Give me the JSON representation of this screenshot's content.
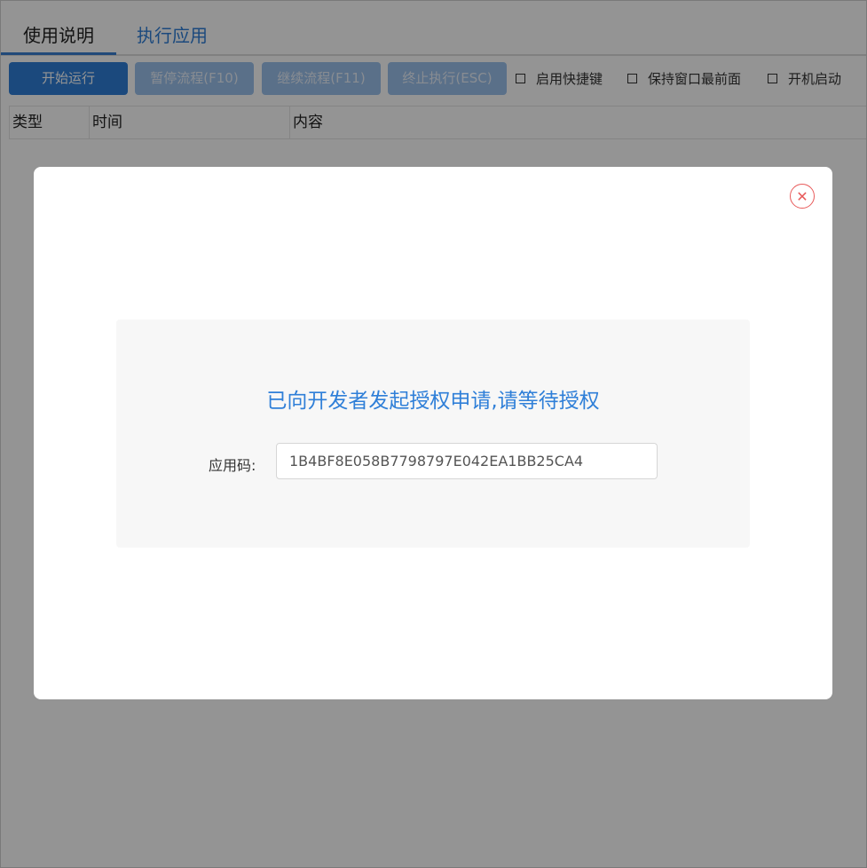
{
  "tabs": [
    {
      "label": "使用说明"
    },
    {
      "label": "执行应用"
    }
  ],
  "toolbar": {
    "start_label": "开始运行",
    "pause_label": "暂停流程(F10)",
    "resume_label": "继续流程(F11)",
    "stop_label": "终止执行(ESC)",
    "hotkey_label": "启用快捷键",
    "ontop_label": "保持窗口最前面",
    "autostart_label": "开机启动"
  },
  "table": {
    "columns": [
      "类型",
      "时间",
      "内容"
    ]
  },
  "modal": {
    "message": "已向开发者发起授权申请,请等待授权",
    "code_label": "应用码:",
    "code_value": "1B4BF8E058B7798797E042EA1BB25CA4"
  },
  "colors": {
    "accent": "#2f7fd8",
    "close": "#e85a5a",
    "disabled_button": "#9bc1ec"
  }
}
